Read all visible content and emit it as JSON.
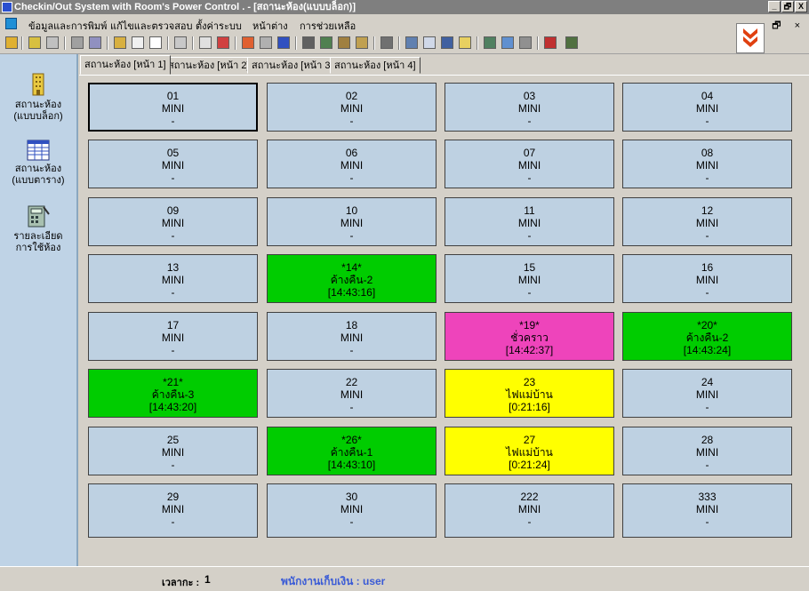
{
  "window": {
    "title": "Checkin/Out System with Room's Power Control . - [สถานะห้อง(แบบบล็อก)]",
    "controls": [
      "_",
      "🗗",
      "X"
    ]
  },
  "menu": {
    "items": [
      "ข้อมูลและการพิมพ์",
      "แก้ไขและตรวจสอบ",
      "ตั้งค่าระบบ",
      "หน้าต่าง",
      "การช่วยเหลือ"
    ],
    "mdi_controls": "- 🗗 ×"
  },
  "sidebar": {
    "items": [
      {
        "label1": "สถานะห้อง",
        "label2": "(แบบบล็อก)",
        "icon": "building-icon"
      },
      {
        "label1": "สถานะห้อง",
        "label2": "(แบบตาราง)",
        "icon": "table-grid-icon"
      },
      {
        "label1": "รายละเอียด",
        "label2": "การใช้ห้อง",
        "icon": "calculator-icon"
      }
    ]
  },
  "tabs": [
    "สถานะห้อง [หน้า 1]",
    "สถานะห้อง [หน้า 2]",
    "สถานะห้อง [หน้า 3]",
    "สถานะห้อง [หน้า 4]"
  ],
  "colors": {
    "vacant": "#bed1e2",
    "occupied_green": "#00cc00",
    "short_stay_pink": "#ee44bb",
    "power_yellow": "#ffff00"
  },
  "rooms": [
    {
      "line1": "01",
      "line2": "MINI",
      "line3": "-",
      "status": "vacant"
    },
    {
      "line1": "02",
      "line2": "MINI",
      "line3": "-",
      "status": "vacant"
    },
    {
      "line1": "03",
      "line2": "MINI",
      "line3": "-",
      "status": "vacant"
    },
    {
      "line1": "04",
      "line2": "MINI",
      "line3": "-",
      "status": "vacant"
    },
    {
      "line1": "05",
      "line2": "MINI",
      "line3": "-",
      "status": "vacant"
    },
    {
      "line1": "06",
      "line2": "MINI",
      "line3": "-",
      "status": "vacant"
    },
    {
      "line1": "07",
      "line2": "MINI",
      "line3": "-",
      "status": "vacant"
    },
    {
      "line1": "08",
      "line2": "MINI",
      "line3": "-",
      "status": "vacant"
    },
    {
      "line1": "09",
      "line2": "MINI",
      "line3": "-",
      "status": "vacant"
    },
    {
      "line1": "10",
      "line2": "MINI",
      "line3": "-",
      "status": "vacant"
    },
    {
      "line1": "11",
      "line2": "MINI",
      "line3": "-",
      "status": "vacant"
    },
    {
      "line1": "12",
      "line2": "MINI",
      "line3": "-",
      "status": "vacant"
    },
    {
      "line1": "13",
      "line2": "MINI",
      "line3": "-",
      "status": "vacant"
    },
    {
      "line1": "*14*",
      "line2": "ค้างคืน-2",
      "line3": "[14:43:16]",
      "status": "occupied_green"
    },
    {
      "line1": "15",
      "line2": "MINI",
      "line3": "-",
      "status": "vacant"
    },
    {
      "line1": "16",
      "line2": "MINI",
      "line3": "-",
      "status": "vacant"
    },
    {
      "line1": "17",
      "line2": "MINI",
      "line3": "-",
      "status": "vacant"
    },
    {
      "line1": "18",
      "line2": "MINI",
      "line3": "-",
      "status": "vacant"
    },
    {
      "line1": "*19*",
      "line2": "ชั่วคราว",
      "line3": "[14:42:37]",
      "status": "short_stay_pink"
    },
    {
      "line1": "*20*",
      "line2": "ค้างคืน-2",
      "line3": "[14:43:24]",
      "status": "occupied_green"
    },
    {
      "line1": "*21*",
      "line2": "ค้างคืน-3",
      "line3": "[14:43:20]",
      "status": "occupied_green"
    },
    {
      "line1": "22",
      "line2": "MINI",
      "line3": "-",
      "status": "vacant"
    },
    {
      "line1": "23",
      "line2": "ไฟแม่บ้าน",
      "line3": "[0:21:16]",
      "status": "power_yellow"
    },
    {
      "line1": "24",
      "line2": "MINI",
      "line3": "-",
      "status": "vacant"
    },
    {
      "line1": "25",
      "line2": "MINI",
      "line3": "-",
      "status": "vacant"
    },
    {
      "line1": "*26*",
      "line2": "ค้างคืน-1",
      "line3": "[14:43:10]",
      "status": "occupied_green"
    },
    {
      "line1": "27",
      "line2": "ไฟแม่บ้าน",
      "line3": "[0:21:24]",
      "status": "power_yellow"
    },
    {
      "line1": "28",
      "line2": "MINI",
      "line3": "-",
      "status": "vacant"
    },
    {
      "line1": "29",
      "line2": "MINI",
      "line3": "-",
      "status": "vacant"
    },
    {
      "line1": "30",
      "line2": "MINI",
      "line3": "-",
      "status": "vacant"
    },
    {
      "line1": "222",
      "line2": "MINI",
      "line3": "-",
      "status": "vacant"
    },
    {
      "line1": "333",
      "line2": "MINI",
      "line3": "-",
      "status": "vacant"
    }
  ],
  "status": {
    "time_label": "เวลากะ :",
    "time_value": "1",
    "cashier": "พนักงานเก็บเงิน : user"
  }
}
